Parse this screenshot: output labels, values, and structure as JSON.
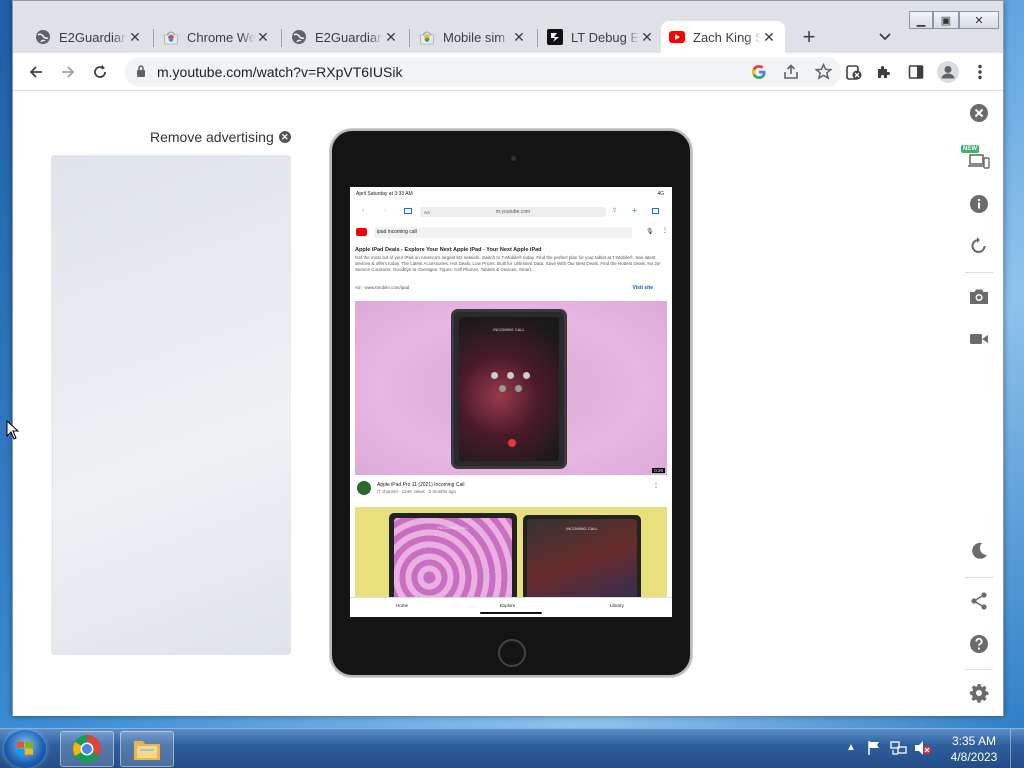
{
  "browser": {
    "tabs": [
      {
        "title": "E2Guardian",
        "icon": "globe-icon"
      },
      {
        "title": "Chrome We",
        "icon": "chrome-webstore-icon"
      },
      {
        "title": "E2Guardian",
        "icon": "globe-icon"
      },
      {
        "title": "Mobile sim",
        "icon": "mobile-simulator-icon"
      },
      {
        "title": "LT Debug E",
        "icon": "lt-debug-icon"
      },
      {
        "title": "Zach King S",
        "icon": "youtube-icon",
        "active": true
      }
    ],
    "url": "m.youtube.com/watch?v=RXpVT6IUSik"
  },
  "page": {
    "remove_ad": "Remove advertising",
    "device": {
      "status_time": "April Saturday at 3:33 AM",
      "status_right": "4G",
      "address": "m.youtube.com",
      "aa": "AA",
      "search_query": "ipad incoming call",
      "ad": {
        "headline": "Apple iPad Deals - Explore Your Next Apple iPad - Your Next Apple iPad",
        "description": "Get the most out of your iPad on America's largest 5G network. Switch to T-Mobile® today. Find the perfect plan for your tablet at T-Mobile®. See latest devices & offers today. The Latest Accessories. Hot Deals, Low Prices. Built for Unlimited Data. Save With Our Best Deals. Find the Hottest Deals. No 2yr Service Contracts. Goodbye to Overages. Types: Cell Phones, Tablets & Devices, Smart...",
        "source": "Ad · www.tmobile.com/ipad",
        "visit": "Visit site"
      },
      "video1": {
        "duration": "0:26",
        "title": "Apple iPad Pro 11 (2021) Incoming Call",
        "meta": "iT channel · 124K views · 2 months ago",
        "screen_text": "INCOMING CALL"
      },
      "video2": {
        "screen_text_a": "INCOMING CALL",
        "screen_text_b": "INCOMING CALL"
      },
      "nav": {
        "home": "Home",
        "explore": "Explore",
        "library": "Library"
      }
    },
    "sidebar_new": "NEW"
  },
  "taskbar": {
    "time": "3:35 AM",
    "date": "4/8/2023"
  },
  "colors": {
    "chrome_frame": "#dee1e6",
    "youtube_red": "#ff0000",
    "accent_blue": "#1a73e8"
  }
}
